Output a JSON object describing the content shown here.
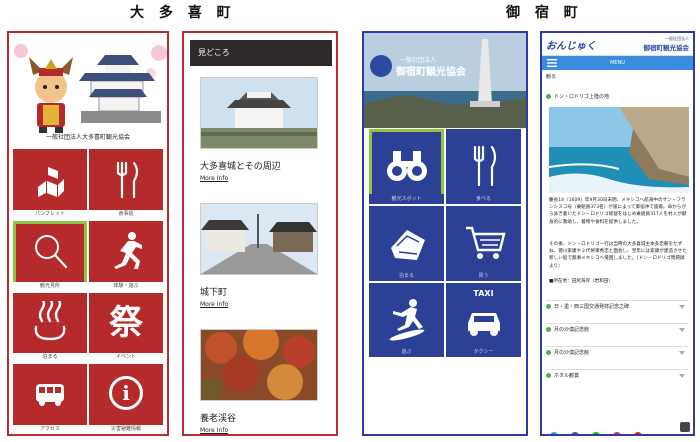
{
  "titles": {
    "otaki": "大 多 喜 町",
    "onjuku": "御 宿 町"
  },
  "colors": {
    "otaki_red": "#b52b2b",
    "onjuku_blue": "#2c4196",
    "highlight_green": "#8cc63f",
    "menu_blue": "#3a8dde"
  },
  "otaki_home": {
    "association": "一般社団法人大多喜町観光協会",
    "tiles": [
      {
        "label": "パンフレット",
        "icon": "pamphlet-icon"
      },
      {
        "label": "食事処",
        "icon": "fork-knife-icon"
      },
      {
        "label": "観光見所",
        "icon": "search-icon",
        "selected": true
      },
      {
        "label": "体験・遊ぶ",
        "icon": "running-person-icon"
      },
      {
        "label": "泊まる",
        "icon": "hot-spring-icon"
      },
      {
        "label": "イベント",
        "icon": "matsuri-kanji-icon",
        "glyph": "祭"
      },
      {
        "label": "アクセス",
        "icon": "bus-icon"
      },
      {
        "label": "災害避難情報",
        "icon": "info-icon",
        "glyph": "i"
      }
    ]
  },
  "otaki_list": {
    "header": "見どころ",
    "items": [
      {
        "title": "大多喜城とその周辺",
        "more": "More Info"
      },
      {
        "title": "城下町",
        "more": "More Info"
      },
      {
        "title": "養老渓谷",
        "more": "More Info"
      }
    ]
  },
  "onjuku_home": {
    "banner_small": "一般社団法人",
    "banner_large": "御宿町観光協会",
    "tiles": [
      {
        "label": "観光スポット",
        "icon": "binoculars-icon",
        "selected": true
      },
      {
        "label": "食べる",
        "icon": "fork-knife-icon"
      },
      {
        "label": "泊まる",
        "icon": "bag-icon"
      },
      {
        "label": "買う",
        "icon": "shopping-cart-icon"
      },
      {
        "label": "遊ぶ",
        "icon": "surfer-icon"
      },
      {
        "label": "タクシー",
        "icon": "taxi-icon",
        "taxi_text": "TAXI"
      }
    ]
  },
  "onjuku_detail": {
    "logo": "おんじゅく",
    "assoc_small": "一般社団法人",
    "assoc_large": "御宿町観光協会",
    "menu": "MENU",
    "breadcrumb": "観る",
    "section_title": "ドン・ロドリゴ上陸の地",
    "paragraph1": "慶長14（1609）年9月30日未明、メキシコへ航海中のサン・フランシスコ号（乗組員373名）が嵐によって御宿沖で座礁。命からがら泳ぎ着いたドン・ロドリゴ総督をはじめ乗組員317人を村人が献身的に救助し、着物や食料を提供しました。",
    "paragraph2": "その後、ドン・ロドリゴ一行は当時の大多喜城主本多忠朝をたずね、徳川家康や２代将軍秀忠と面会し、翌年には家康が建造させた新しい船で無事メキシコへ帰国しました。（ドン・ロドリゴ問題録より）",
    "location": "■所在地：田尻海岸（岩和田）",
    "more_sections": [
      "日・墨・西三国交通発祥記念之碑",
      "月の沙漠記念館",
      "月の沙漠記念館",
      "ホタル観賞"
    ],
    "social": [
      "twitter-icon",
      "facebook-icon",
      "line-icon",
      "instagram-icon",
      "youtube-icon"
    ]
  }
}
